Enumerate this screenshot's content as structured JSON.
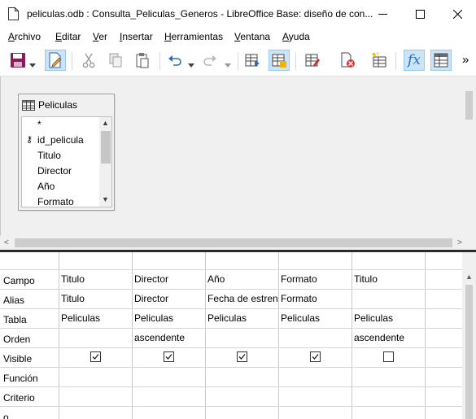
{
  "window": {
    "title": "peliculas.odb : Consulta_Peliculas_Generos - LibreOffice Base: diseño de con...",
    "minimize_glyph": "—",
    "close_glyph": "✕"
  },
  "menu": [
    {
      "label": "Archivo",
      "u": "A",
      "rest": "rchivo"
    },
    {
      "label": "Editar",
      "u": "E",
      "rest": "ditar"
    },
    {
      "label": "Ver",
      "u": "V",
      "rest": "er"
    },
    {
      "label": "Insertar",
      "u": "I",
      "rest": "nsertar"
    },
    {
      "label": "Herramientas",
      "u": "H",
      "rest": "erramientas"
    },
    {
      "label": "Ventana",
      "u": "V",
      "rest": "entana"
    },
    {
      "label": "Ayuda",
      "u": "A",
      "rest": "yuda"
    }
  ],
  "toolbar": {
    "overflow": "»",
    "icons": [
      "save-icon",
      "edit-design-icon",
      "cut-icon",
      "copy-icon",
      "paste-icon",
      "undo-icon",
      "redo-icon",
      "run-query-icon",
      "clear-query-icon",
      "add-table-icon",
      "switch-design-icon",
      "delete-icon",
      "add-table-new-icon",
      "functions-icon",
      "table-names-icon"
    ]
  },
  "table_window": {
    "name": "Peliculas",
    "fields": [
      "*",
      "id_pelicula",
      "Titulo",
      "Director",
      "Año",
      "Formato"
    ],
    "primary_key_field": "id_pelicula",
    "scroll_up": "▲",
    "scroll_down": "▼",
    "key_glyph": "⚷"
  },
  "scroll": {
    "left": "<",
    "right": ">",
    "up": "▲"
  },
  "grid": {
    "row_labels": [
      "Campo",
      "Alias",
      "Tabla",
      "Orden",
      "Visible",
      "Función",
      "Criterio",
      "o"
    ],
    "columns": [
      {
        "campo": "Titulo",
        "alias": "Titulo",
        "tabla": "Peliculas",
        "orden": "",
        "visible": true
      },
      {
        "campo": "Director",
        "alias": "Director",
        "tabla": "Peliculas",
        "orden": "ascendente",
        "visible": true
      },
      {
        "campo": "Año",
        "alias": "Fecha de estreno",
        "tabla": "Peliculas",
        "orden": "",
        "visible": true
      },
      {
        "campo": "Formato",
        "alias": "Formato",
        "tabla": "Peliculas",
        "orden": "",
        "visible": true
      },
      {
        "campo": "Titulo",
        "alias": "",
        "tabla": "Peliculas",
        "orden": "ascendente",
        "visible": false
      }
    ],
    "check_glyph": "✓"
  },
  "colors": {
    "active_button_bg": "#cce4f7",
    "save_icon": "#8b1a5a",
    "splitter": "#2b2b2b"
  }
}
